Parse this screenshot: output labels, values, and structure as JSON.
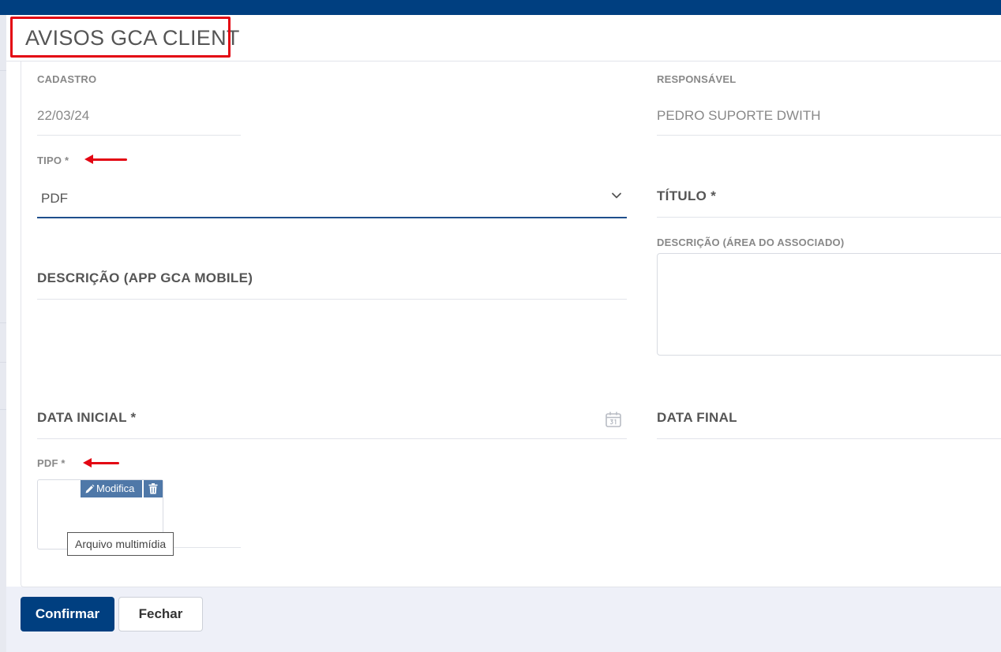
{
  "modal": {
    "title": "AVISOS GCA CLIENT"
  },
  "form": {
    "cadastro": {
      "label": "CADASTRO",
      "value": "22/03/24"
    },
    "responsavel": {
      "label": "RESPONSÁVEL",
      "value": "PEDRO SUPORTE DWITH"
    },
    "tipo": {
      "label": "TIPO *",
      "value": "PDF"
    },
    "titulo": {
      "label": "TÍTULO *",
      "value": ""
    },
    "descricao_area": {
      "label": "DESCRIÇÃO (ÁREA DO ASSOCIADO)",
      "value": ""
    },
    "descricao_app": {
      "label": "DESCRIÇÃO (APP GCA MOBILE)",
      "value": ""
    },
    "data_inicial": {
      "label": "DATA INICIAL *",
      "value": ""
    },
    "data_final": {
      "label": "DATA FINAL",
      "value": ""
    },
    "pdf": {
      "label": "PDF *",
      "modify_label": "Modifica",
      "tooltip": "Arquivo multimídia"
    }
  },
  "footer": {
    "confirm_label": "Confirmar",
    "close_label": "Fechar"
  },
  "colors": {
    "primary": "#003f80",
    "annotation": "#e30613",
    "secondary_button": "#4f78a8"
  },
  "icons": [
    "chevron-down-icon",
    "calendar-icon",
    "pencil-icon",
    "trash-icon"
  ]
}
